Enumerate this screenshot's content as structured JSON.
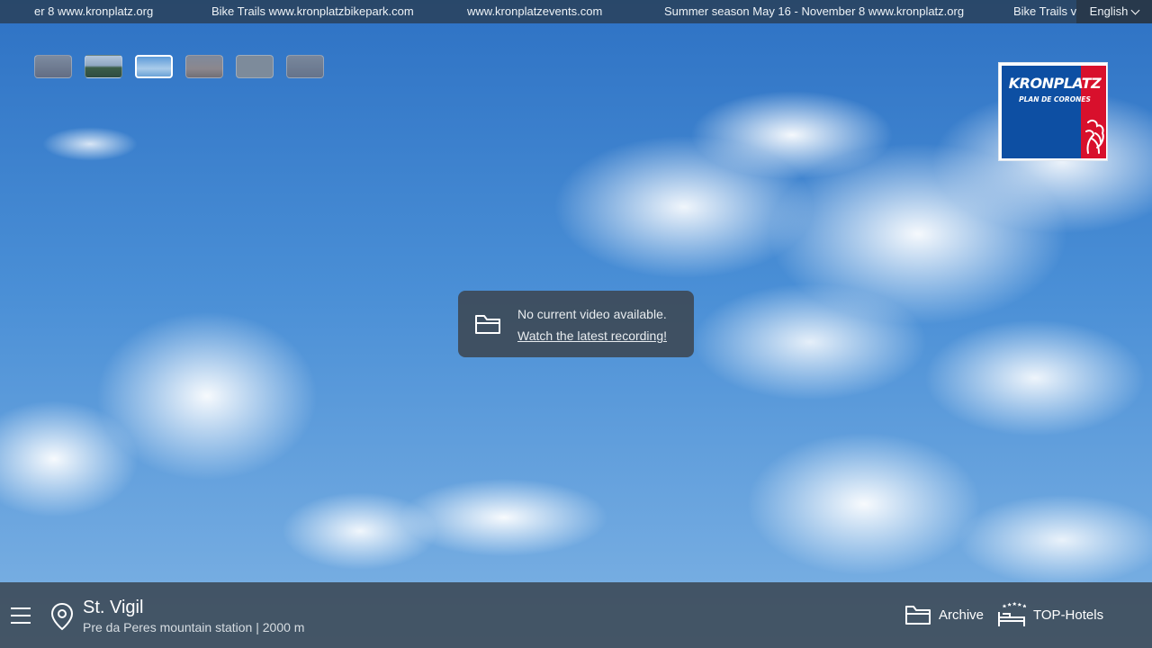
{
  "ticker": {
    "items": [
      "er 8 www.kronplatz.org",
      "Bike Trails www.kronplatzbikepark.com",
      "www.kronplatzevents.com",
      "Summer season May 16 - November 8 www.kronplatz.org",
      "Bike Trails v"
    ]
  },
  "language": {
    "selected": "English"
  },
  "thumbnails": {
    "count": 6,
    "active_index": 2
  },
  "logo": {
    "title": "KRONPLATZ",
    "subtitle": "PLAN DE CORONES"
  },
  "message": {
    "text": "No current video available.",
    "link": "Watch the latest recording!"
  },
  "location": {
    "name": "St. Vigil",
    "subtitle": "Pre da Peres mountain station | 2000 m"
  },
  "actions": {
    "archive": "Archive",
    "hotels": "TOP-Hotels"
  },
  "icons": {
    "menu": "menu-icon",
    "pin": "location-pin-icon",
    "folder": "folder-icon",
    "hotel": "hotel-bed-icon",
    "chevron": "chevron-down-icon"
  }
}
